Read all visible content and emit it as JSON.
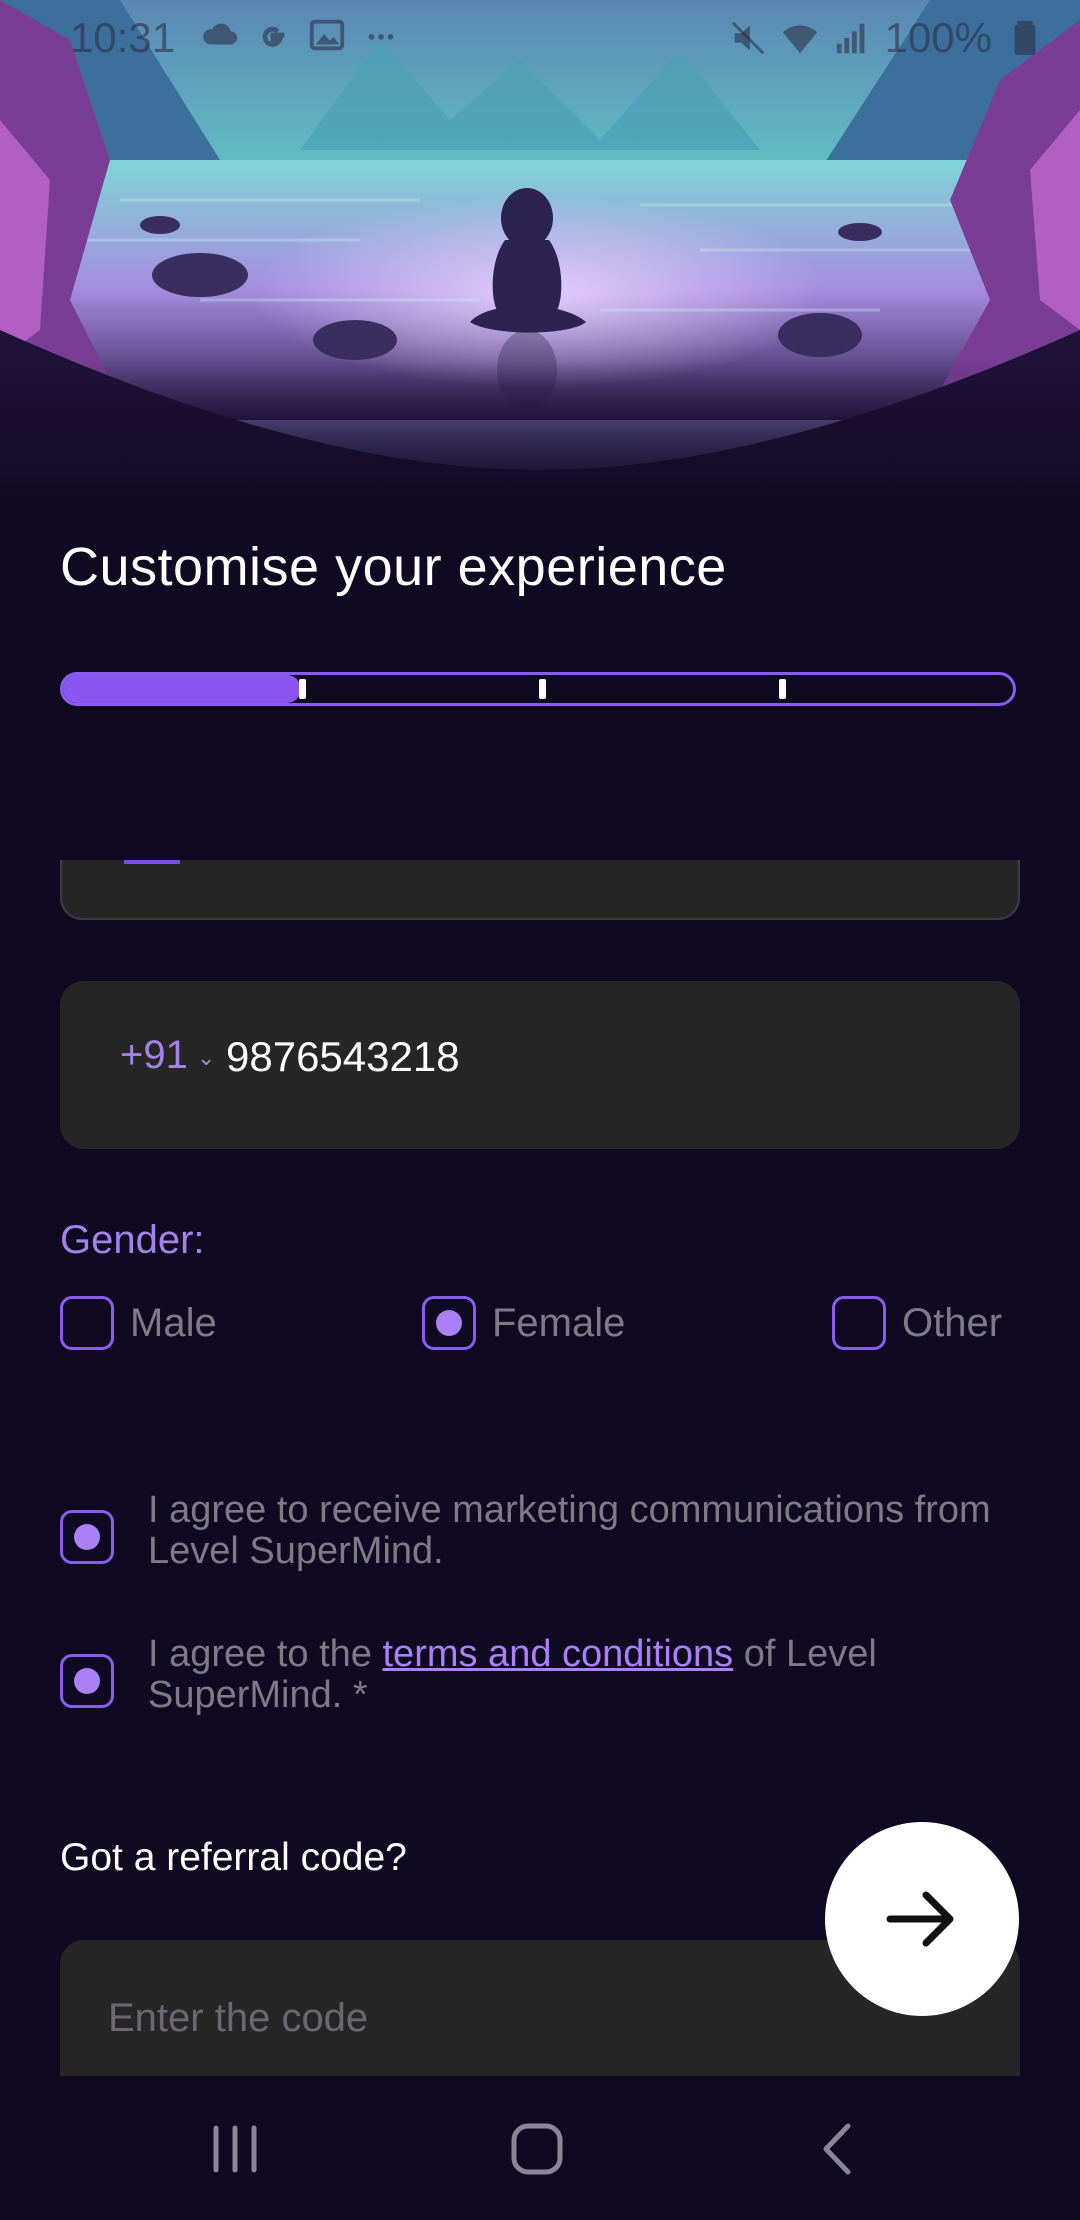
{
  "status_bar": {
    "time": "10:31",
    "battery": "100%",
    "left_icons": [
      "cloud-icon",
      "google-icon",
      "image-icon",
      "more-icon"
    ],
    "right_icons": [
      "mute-icon",
      "wifi-icon",
      "signal-icon",
      "battery-icon"
    ]
  },
  "page": {
    "title": "Customise your experience"
  },
  "progress": {
    "fraction": 0.25,
    "steps": 4
  },
  "phone": {
    "country_code": "+91",
    "number": "9876543218"
  },
  "gender": {
    "label": "Gender:",
    "options": [
      {
        "label": "Male",
        "selected": false
      },
      {
        "label": "Female",
        "selected": true
      },
      {
        "label": "Other",
        "selected": false
      }
    ]
  },
  "consents": {
    "marketing": {
      "text": "I agree to receive marketing communications from Level SuperMind.",
      "checked": true
    },
    "terms": {
      "prefix": "I agree to the ",
      "link": "terms and conditions",
      "suffix": " of Level SuperMind. *",
      "checked": true
    }
  },
  "referral": {
    "label": "Got a referral code?",
    "placeholder": "Enter the code"
  },
  "colors": {
    "background": "#100922",
    "accent": "#8b55f1",
    "field": "#262626"
  }
}
